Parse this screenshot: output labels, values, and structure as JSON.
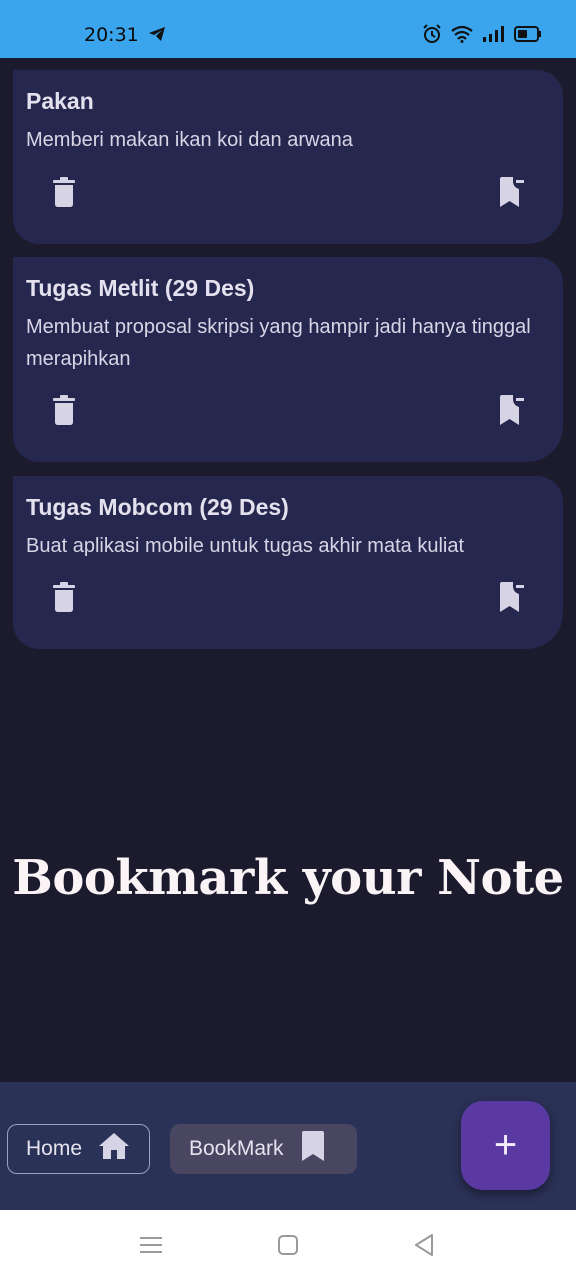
{
  "status_bar": {
    "time": "20:31",
    "icons": [
      "telegram-icon",
      "alarm-icon",
      "wifi-icon",
      "signal-icon",
      "battery-icon"
    ]
  },
  "notes": [
    {
      "title": "Pakan",
      "body": "Memberi makan ikan koi dan arwana"
    },
    {
      "title": "Tugas Metlit (29 Des)",
      "body": "Membuat proposal skripsi yang hampir jadi hanya tinggal merapihkan"
    },
    {
      "title": "Tugas Mobcom (29 Des)",
      "body": "Buat aplikasi mobile untuk tugas akhir mata kuliat"
    }
  ],
  "banner": "Bookmark your Note",
  "bottom_nav": {
    "home_label": "Home",
    "bookmark_label": "BookMark",
    "add_label": "+"
  },
  "colors": {
    "status_bar": "#3aa4ec",
    "background": "#1c1b2e",
    "card": "#26274f",
    "fab": "#5a3aa2",
    "bottom_bar": "#2b3257"
  }
}
